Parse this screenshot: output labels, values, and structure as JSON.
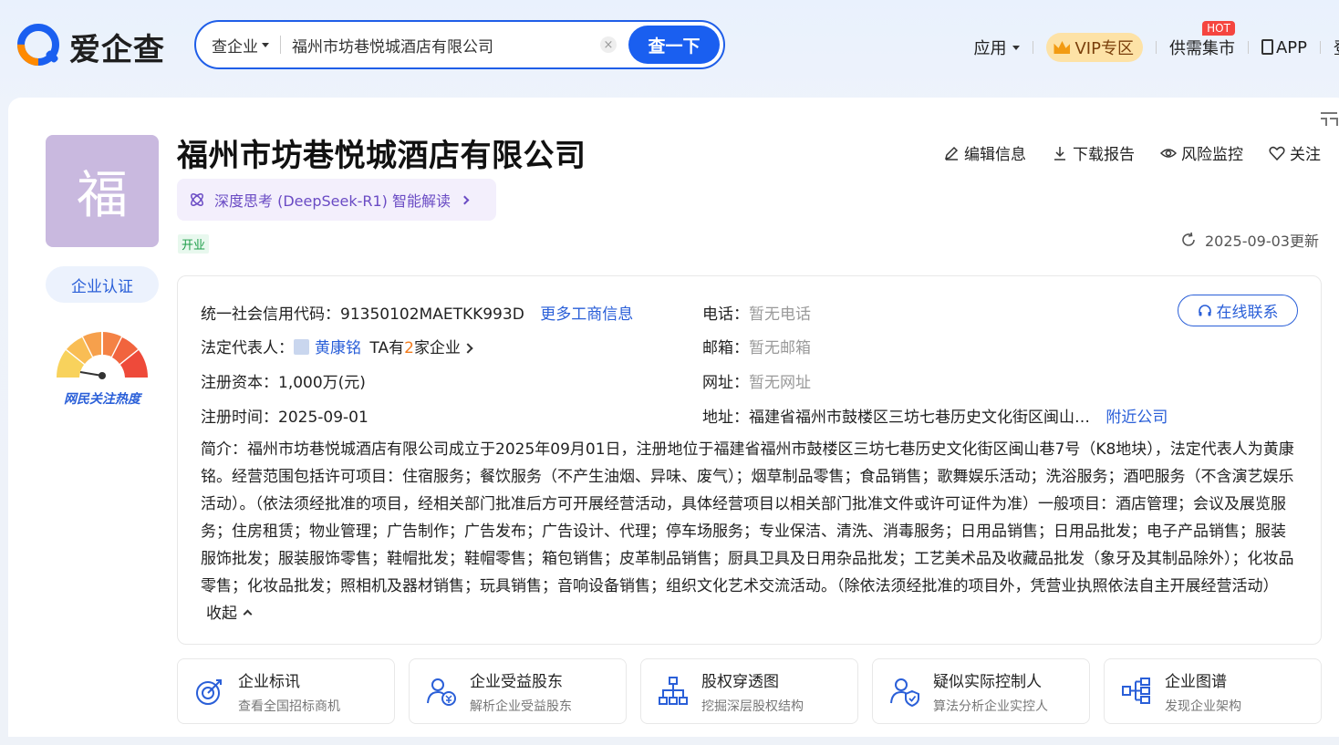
{
  "brand": {
    "name": "爱企查"
  },
  "search": {
    "type_label": "查企业",
    "query": "福州市坊巷悦城酒店有限公司",
    "button_label": "查一下",
    "clear_icon": "×"
  },
  "topnav": {
    "apps_label": "应用",
    "vip_label": "VIP专区",
    "market_label": "供需集市",
    "hot_badge": "HOT",
    "app_label": "APP",
    "cut_label": "登"
  },
  "company": {
    "avatar_char": "福",
    "certify_label": "企业认证",
    "gauge_label": "网民关注热度",
    "name": "福州市坊巷悦城酒店有限公司",
    "ai_label": "深度思考 (DeepSeek-R1) 智能解读",
    "status": "开业",
    "update_text": "2025-09-03更新"
  },
  "actions": {
    "edit": "编辑信息",
    "download": "下载报告",
    "monitor": "风险监控",
    "follow": "关注"
  },
  "info": {
    "credit_label": "统一社会信用代码：",
    "credit_value": "91350102MAETKK993D",
    "more_info": "更多工商信息",
    "legal_label": "法定代表人：",
    "legal_name": "黄康铭",
    "ta_prefix": "TA有",
    "ta_count": "2",
    "ta_suffix": "家企业",
    "capital_label": "注册资本：",
    "capital_value": "1,000万(元)",
    "date_label": "注册时间：",
    "date_value": "2025-09-01",
    "phone_label": "电话：",
    "phone_value": "暂无电话",
    "email_label": "邮箱：",
    "email_value": "暂无邮箱",
    "website_label": "网址：",
    "website_value": "暂无网址",
    "address_label": "地址：",
    "address_value": "福建省福州市鼓楼区三坊七巷历史文化街区闽山…",
    "nearby": "附近公司",
    "contact_btn": "在线联系",
    "intro": "简介：福州市坊巷悦城酒店有限公司成立于2025年09月01日，注册地位于福建省福州市鼓楼区三坊七巷历史文化街区闽山巷7号（K8地块），法定代表人为黄康铭。经营范围包括许可项目：住宿服务；餐饮服务（不产生油烟、异味、废气）；烟草制品零售；食品销售；歌舞娱乐活动；洗浴服务；酒吧服务（不含演艺娱乐活动）。（依法须经批准的项目，经相关部门批准后方可开展经营活动，具体经营项目以相关部门批准文件或许可证件为准）一般项目：酒店管理；会议及展览服务；住房租赁；物业管理；广告制作；广告发布；广告设计、代理；停车场服务；专业保洁、清洗、消毒服务；日用品销售；日用品批发；电子产品销售；服装服饰批发；服装服饰零售；鞋帽批发；鞋帽零售；箱包销售；皮革制品销售；厨具卫具及日用杂品批发；工艺美术品及收藏品批发（象牙及其制品除外）；化妆品零售；化妆品批发；照相机及器材销售；玩具销售；音响设备销售；组织文化艺术交流活动。（除依法须经批准的项目外，凭营业执照依法自主开展经营活动）",
    "collapse": "收起"
  },
  "features": [
    {
      "title": "企业标讯",
      "sub": "查看全国招标商机",
      "icon": "target-icon"
    },
    {
      "title": "企业受益股东",
      "sub": "解析企业受益股东",
      "icon": "shareholder-icon"
    },
    {
      "title": "股权穿透图",
      "sub": "挖掘深层股权结构",
      "icon": "org-chart-icon"
    },
    {
      "title": "疑似实际控制人",
      "sub": "算法分析企业实控人",
      "icon": "controller-icon"
    },
    {
      "title": "企业图谱",
      "sub": "发现企业架构",
      "icon": "graph-icon"
    }
  ],
  "colors": {
    "brand_blue": "#1a5ff0",
    "link_blue": "#2a5fd8",
    "avatar_purple": "#c9b9df",
    "status_green": "#1c9d48",
    "ai_purple": "#6a4bc4"
  }
}
